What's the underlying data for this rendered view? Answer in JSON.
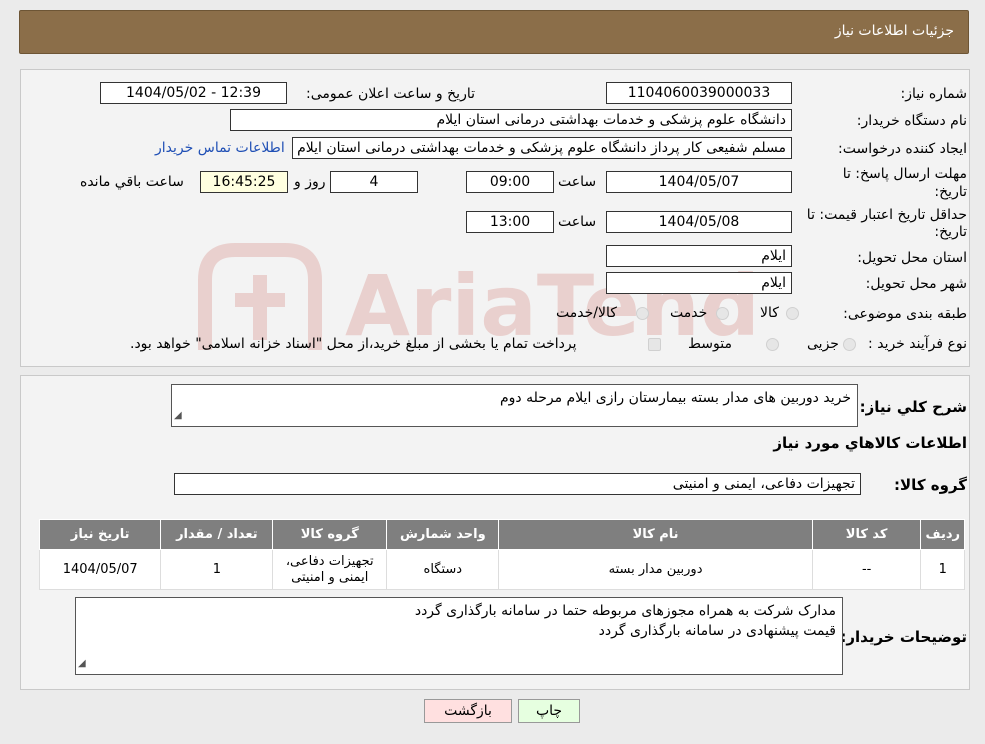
{
  "header": {
    "title": "جزئیات اطلاعات نیاز"
  },
  "form": {
    "need_number_label": "شماره نیاز:",
    "need_number": "1104060039000033",
    "announce_label": "تاریخ و ساعت اعلان عمومی:",
    "announce_value": "1404/05/02 - 12:39",
    "buyer_org_label": "نام دستگاه خریدار:",
    "buyer_org": "دانشگاه علوم پزشکی و خدمات بهداشتی درمانی استان ایلام",
    "creator_label": "ایجاد کننده درخواست:",
    "creator": "مسلم شفیعی کار پرداز  دانشگاه علوم پزشکی و خدمات بهداشتی درمانی استان ایلام",
    "contact_link": "اطلاعات تماس خریدار",
    "deadline_label_1": "مهلت ارسال پاسخ: تا",
    "deadline_label_2": "تاریخ:",
    "deadline_date": "1404/05/07",
    "time_label": "ساعت",
    "deadline_time": "09:00",
    "days_value": "4",
    "days_label": "روز و",
    "remaining_time": "16:45:25",
    "remaining_label": "ساعت باقي مانده",
    "validity_label_1": "حداقل تاریخ اعتبار قیمت: تا",
    "validity_label_2": "تاریخ:",
    "validity_date": "1404/05/08",
    "validity_time": "13:00",
    "province_label": "استان محل تحویل:",
    "province": "ایلام",
    "city_label": "شهر محل تحویل:",
    "city": "ایلام",
    "category_label": "طبقه بندی موضوعی:",
    "category_options": [
      "کالا",
      "خدمت",
      "کالا/خدمت"
    ],
    "process_label": "نوع فرآیند خرید :",
    "process_options": [
      "جزیی",
      "متوسط"
    ],
    "process_note": "پرداخت تمام یا بخشی از مبلغ خرید،از محل \"اسناد خزانه اسلامی\" خواهد بود."
  },
  "summary": {
    "label": "شرح کلي نياز:",
    "value": "خرید دوربین های  مدار بسته بیمارستان رازی ایلام مرحله دوم",
    "goods_info_title": "اطلاعات کالاهاي مورد نياز",
    "group_label": "گروه کالا:",
    "group_value": "تجهیزات دفاعی، ایمنی و امنیتی"
  },
  "table": {
    "headers": [
      "رديف",
      "کد کالا",
      "نام کالا",
      "واحد شمارش",
      "گروه کالا",
      "تعداد / مقدار",
      "تاريخ نياز"
    ],
    "rows": [
      [
        "1",
        "--",
        "دوربین مدار بسته",
        "دستگاه",
        "تجهیزات دفاعی، ایمنی و امنیتی",
        "1",
        "1404/05/07"
      ]
    ]
  },
  "buyer_notes": {
    "label": "توضیحات خریدار:",
    "line1": "مدارک شرکت به همراه مجوزهای مربوطه حتما در سامانه بارگذاری گردد",
    "line2": "قیمت پیشنهادی در سامانه بارگذاری گردد"
  },
  "buttons": {
    "print": "چاپ",
    "back": "بازگشت"
  },
  "colors": {
    "header": "#8b6e49",
    "table_header": "#7f7f7f",
    "back_button": "#ffe0e0",
    "print_button": "#e6ffe0",
    "link": "#1f4fb5"
  }
}
